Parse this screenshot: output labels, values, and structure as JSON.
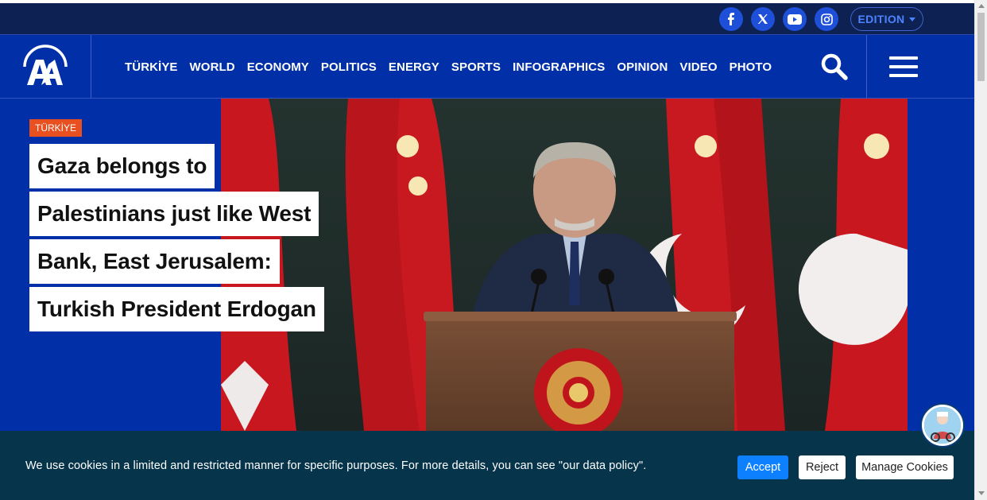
{
  "social": {
    "facebook_icon": "facebook-icon",
    "x_icon": "x-icon",
    "youtube_icon": "youtube-icon",
    "instagram_icon": "instagram-icon",
    "edition_label": "EDITION"
  },
  "nav": {
    "logo": "AA",
    "items": [
      "TÜRKİYE",
      "WORLD",
      "ECONOMY",
      "POLITICS",
      "ENERGY",
      "SPORTS",
      "INFOGRAPHICS",
      "OPINION",
      "VIDEO",
      "PHOTO"
    ],
    "search_icon": "search-icon",
    "menu_icon": "hamburger-menu-icon"
  },
  "hero": {
    "category": "TÜRKİYE",
    "headline_lines": [
      "Gaza belongs to",
      "Palestinians just like West",
      "Bank, East Jerusalem:",
      "Turkish President Erdogan"
    ]
  },
  "cookie": {
    "text": "We use cookies in a limited and restricted manner for specific purposes. For more details, you can see \"our data policy\".",
    "accept": "Accept",
    "reject": "Reject",
    "manage": "Manage Cookies"
  },
  "colors": {
    "brand_blue": "#002fa7",
    "top_bar": "#0d2153",
    "tag_orange": "#e8501f",
    "cookie_bg": "#06344b",
    "accept_blue": "#0d80ff"
  }
}
